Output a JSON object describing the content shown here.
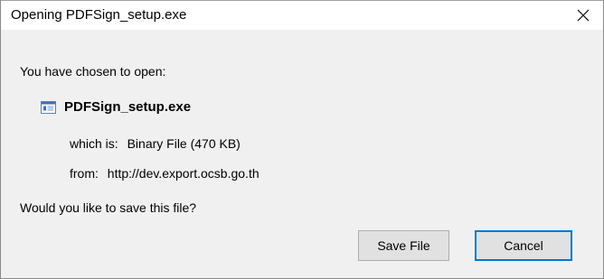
{
  "window": {
    "title": "Opening PDFSign_setup.exe"
  },
  "dialog": {
    "chosen_label": "You have chosen to open:",
    "file_name": "PDFSign_setup.exe",
    "which_label": "which is:",
    "which_value": "Binary File (470 KB)",
    "from_label": "from:",
    "from_value": "http://dev.export.ocsb.go.th",
    "question": "Would you like to save this file?"
  },
  "buttons": {
    "save_label": "Save File",
    "cancel_label": "Cancel"
  },
  "icons": {
    "close": "close-icon",
    "file": "executable-file-icon"
  },
  "colors": {
    "accent": "#0078d7",
    "client_bg": "#f0f0f0",
    "button_bg": "#e1e1e1"
  }
}
